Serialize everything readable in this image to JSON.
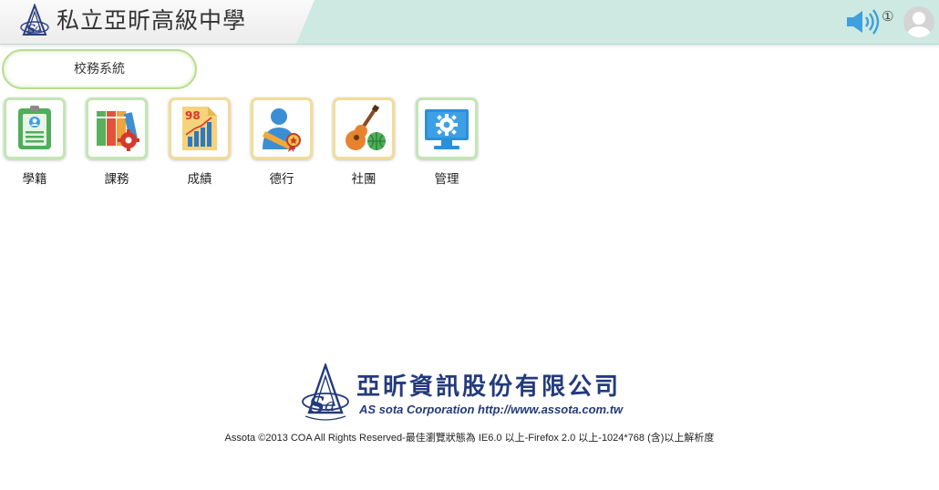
{
  "header": {
    "school_name": "私立亞昕高級中學",
    "notification_count": "①"
  },
  "system": {
    "label": "校務系統"
  },
  "modules": [
    {
      "label": "學籍",
      "icon": "student-id-icon"
    },
    {
      "label": "課務",
      "icon": "books-gear-icon"
    },
    {
      "label": "成績",
      "icon": "score-chart-icon"
    },
    {
      "label": "德行",
      "icon": "conduct-medal-icon"
    },
    {
      "label": "社團",
      "icon": "guitar-ball-icon"
    },
    {
      "label": "管理",
      "icon": "monitor-gear-icon"
    }
  ],
  "footer": {
    "company_cn": "亞昕資訊股份有限公司",
    "company_en": "AS sota Corporation  http://www.assota.com.tw",
    "copyright": "Assota ©2013 COA All Rights Reserved-最佳瀏覽狀態為 IE6.0 以上-Firefox 2.0 以上-1024*768 (含)以上解析度"
  },
  "colors": {
    "header_bg": "#cde9e1",
    "pill_border": "#b7dd8e",
    "tile_border_green": "#c2e6b4",
    "tile_border_yellow": "#f3dc97",
    "company_blue": "#233a7c",
    "speaker_blue": "#3ea0dc"
  }
}
